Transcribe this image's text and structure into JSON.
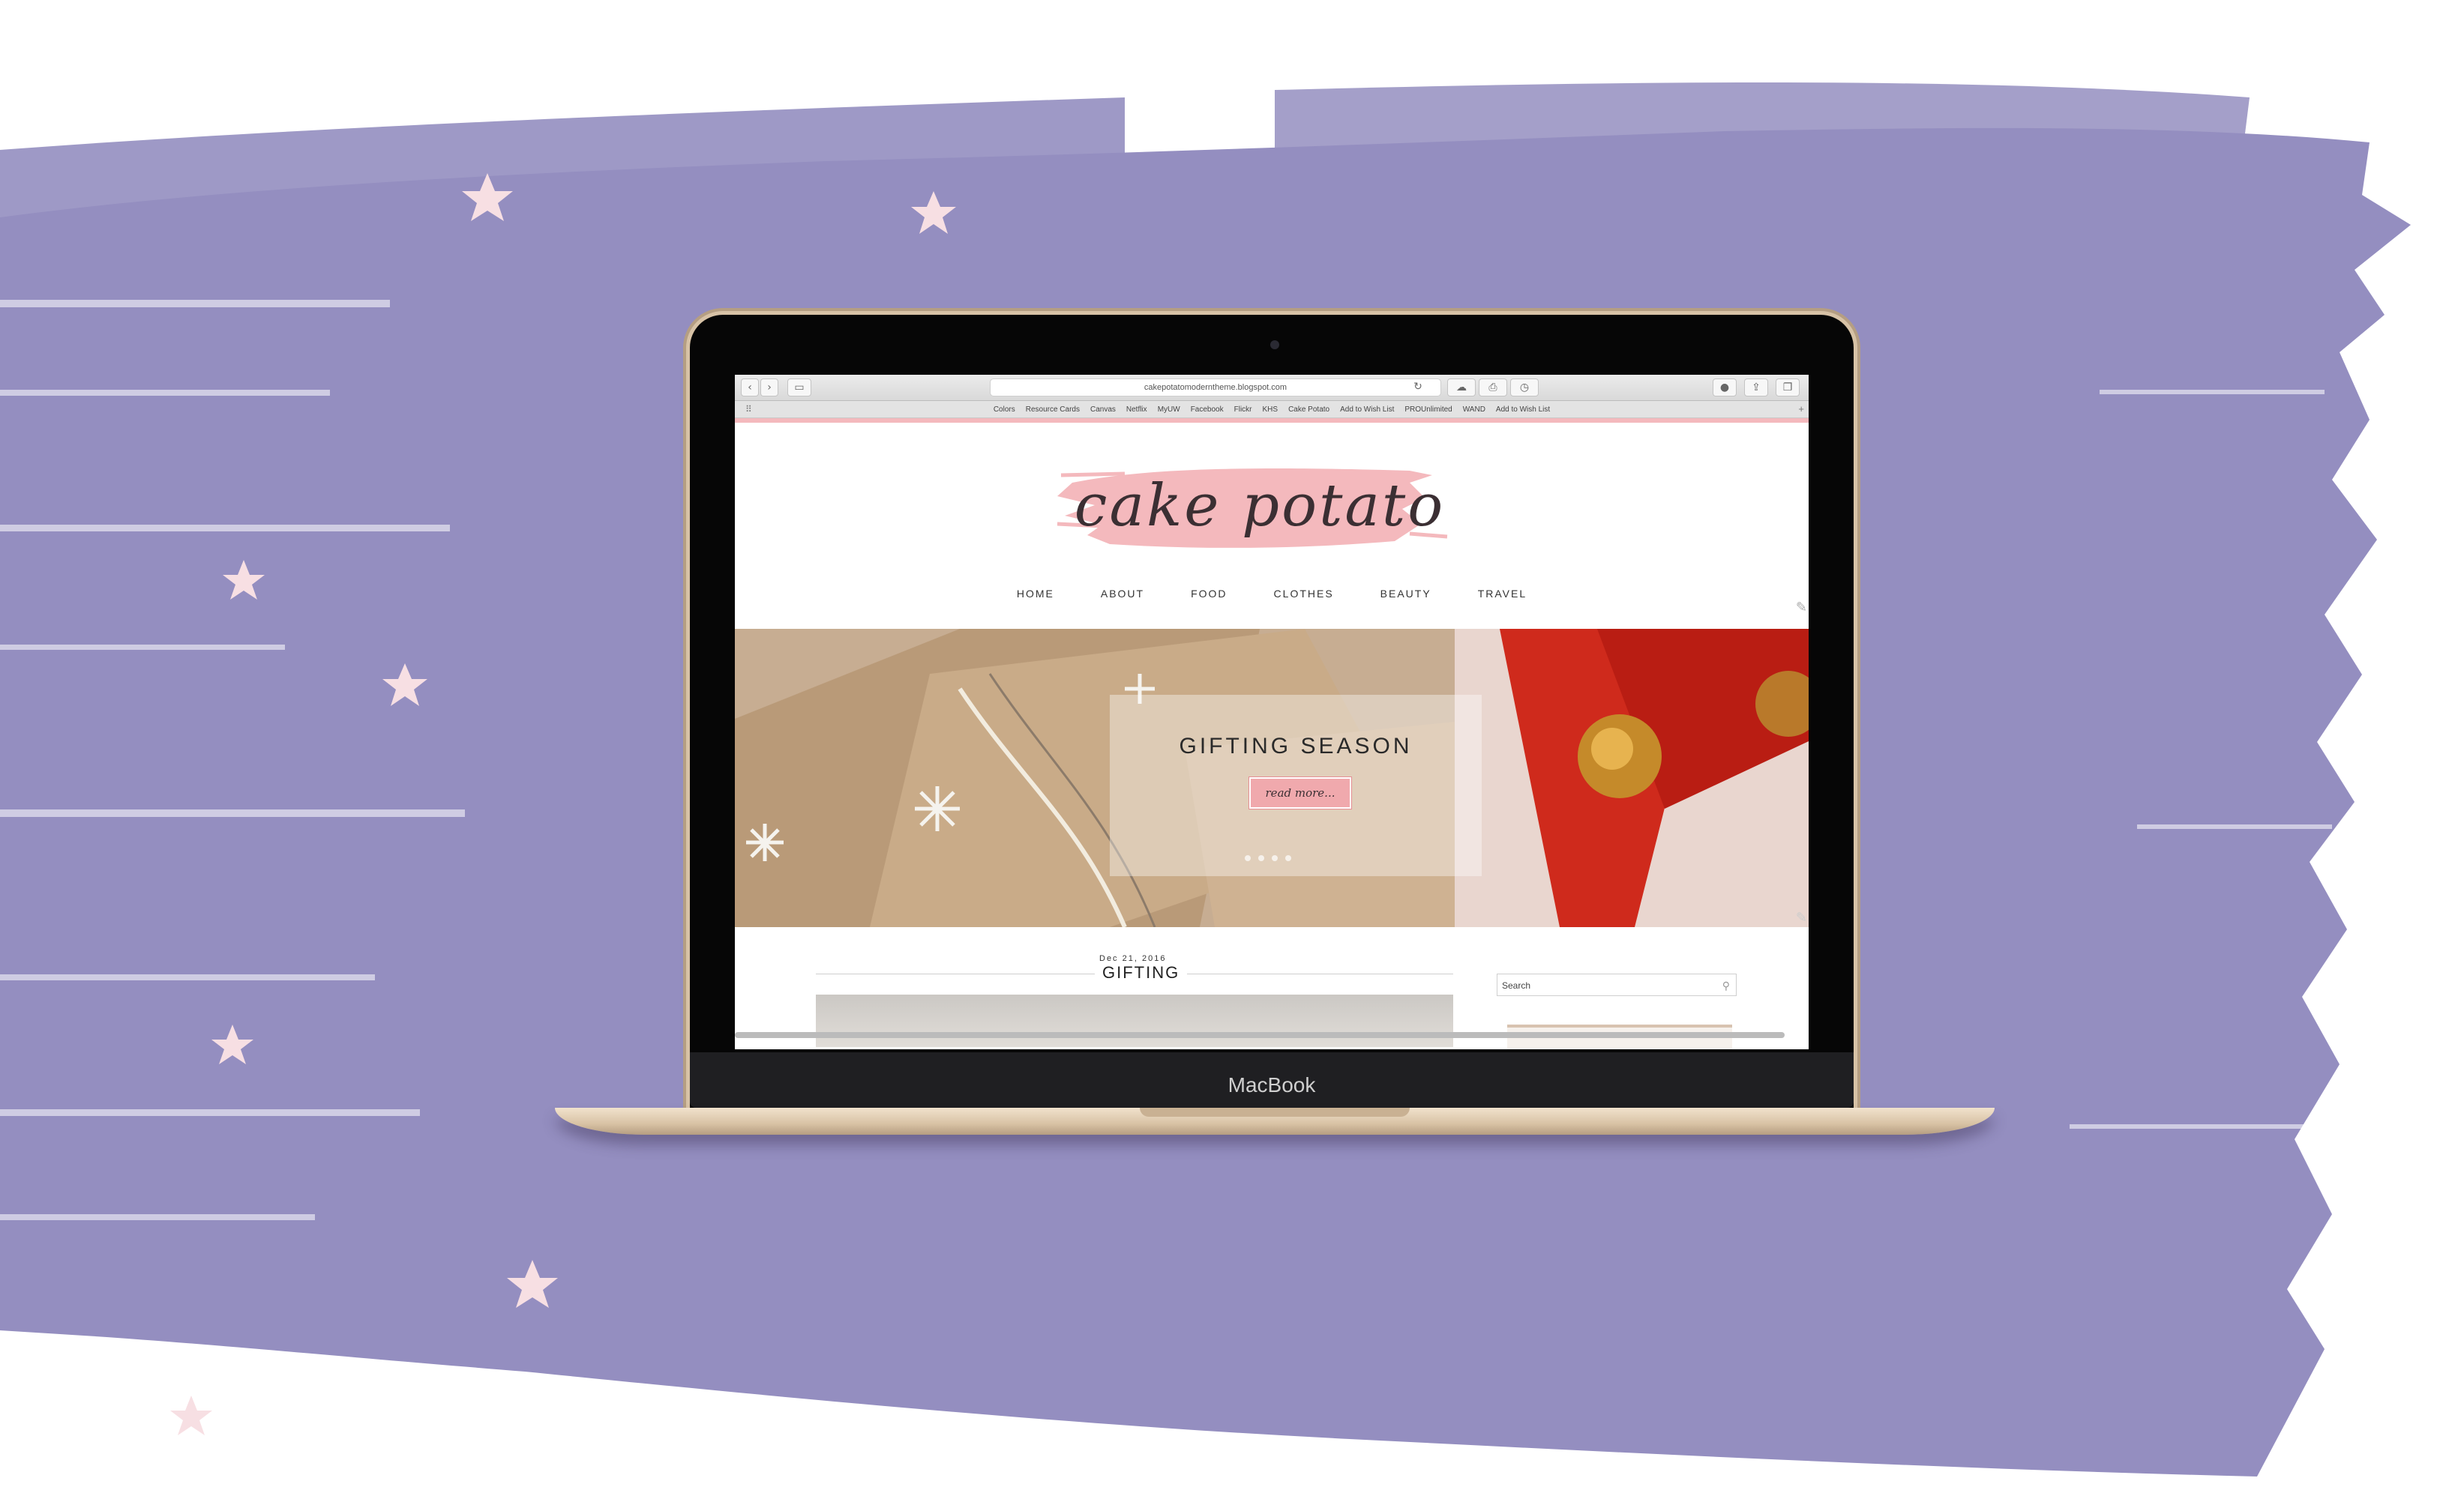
{
  "device": {
    "label": "MacBook"
  },
  "browser": {
    "url": "cakepotatomoderntheme.blogspot.com",
    "bookmarks": [
      "Colors",
      "Resource Cards",
      "Canvas",
      "Netflix",
      "MyUW",
      "Facebook",
      "Flickr",
      "KHS",
      "Cake Potato",
      "Add to Wish List",
      "PROUnlimited",
      "WAND",
      "Add to Wish List"
    ]
  },
  "site": {
    "logo": "cake potato",
    "nav": [
      "HOME",
      "ABOUT",
      "FOOD",
      "CLOTHES",
      "BEAUTY",
      "TRAVEL"
    ],
    "hero": {
      "title": "GIFTING SEASON",
      "button": "read more..."
    },
    "post": {
      "date": "Dec 21, 2016",
      "title": "GIFTING"
    },
    "sidebar": {
      "search_placeholder": "Search"
    }
  },
  "colors": {
    "brush_purple": "#948ec0",
    "accent_pink": "#f4b9bd",
    "star_pink": "#f7dfe3"
  }
}
